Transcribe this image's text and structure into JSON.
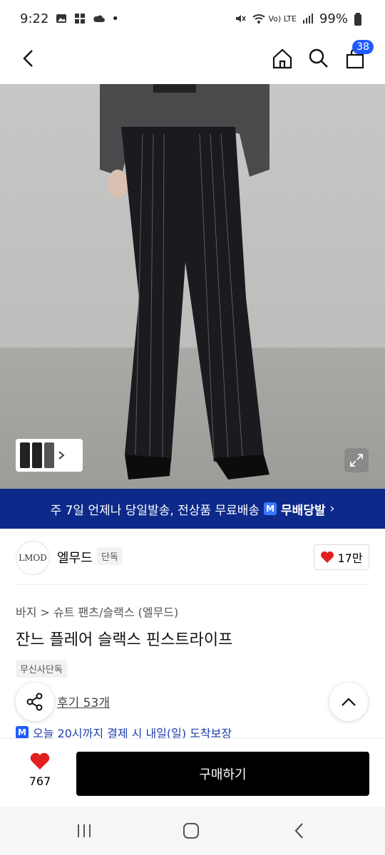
{
  "status_bar": {
    "time": "9:22",
    "network_label": "Vo) LTE",
    "battery": "99%"
  },
  "header": {
    "cart_count": "38"
  },
  "banner": {
    "text": "주 7일 언제나 당일발송, 전상품 무료배송",
    "m_label": "M",
    "link_label": "무배당발",
    "chevron": "›"
  },
  "brand": {
    "logo_text": "LMOD",
    "name": "엘무드",
    "tag": "단독",
    "likes": "17만"
  },
  "product": {
    "breadcrumb": "바지 > 슈트 팬츠/슬랙스 (엘무드)",
    "title": "잔느 플레어 슬랙스 핀스트라이프",
    "tag": "무신사단독",
    "review_link": "후기 53개",
    "delivery": "오늘 20시까지 결제 시 내일(일) 도착보장"
  },
  "bottom": {
    "like_count": "767",
    "buy_label": "구매하기"
  },
  "colors": {
    "banner_bg": "#0d2a8a",
    "badge_blue": "#1f5cff",
    "heart_red": "#e02020",
    "buy_bg": "#000000"
  }
}
